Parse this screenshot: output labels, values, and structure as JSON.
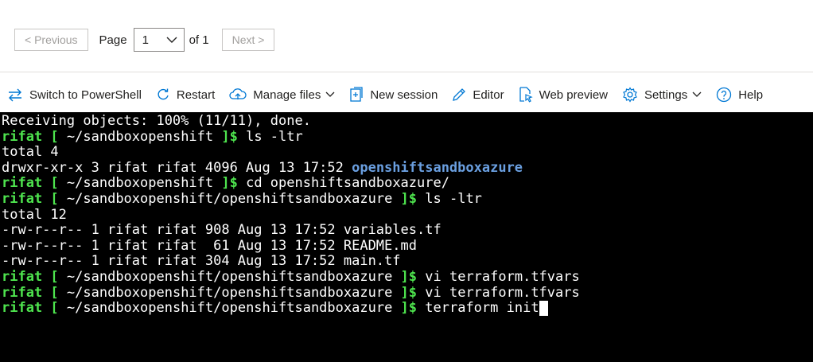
{
  "pagination": {
    "previous_label": "< Previous",
    "page_label": "Page",
    "current_page": "1",
    "of_label": "of 1",
    "next_label": "Next >"
  },
  "toolbar": {
    "switch_label": "Switch to PowerShell",
    "restart_label": "Restart",
    "manage_files_label": "Manage files",
    "new_session_label": "New session",
    "editor_label": "Editor",
    "web_preview_label": "Web preview",
    "settings_label": "Settings",
    "help_label": "Help"
  },
  "terminal": {
    "prompt_user": "rifat",
    "lines": [
      {
        "type": "output",
        "text": "Receiving objects: 100% (11/11), done."
      },
      {
        "type": "prompt",
        "path": "~/sandboxopenshift",
        "cmd": "ls -ltr"
      },
      {
        "type": "output",
        "text": "total 4"
      },
      {
        "type": "dirline",
        "text": "drwxr-xr-x 3 rifat rifat 4096 Aug 13 17:52 ",
        "dir": "openshiftsandboxazure"
      },
      {
        "type": "prompt",
        "path": "~/sandboxopenshift",
        "cmd": "cd openshiftsandboxazure/"
      },
      {
        "type": "prompt",
        "path": "~/sandboxopenshift/openshiftsandboxazure",
        "cmd": "ls -ltr"
      },
      {
        "type": "output",
        "text": "total 12"
      },
      {
        "type": "output",
        "text": "-rw-r--r-- 1 rifat rifat 908 Aug 13 17:52 variables.tf"
      },
      {
        "type": "output",
        "text": "-rw-r--r-- 1 rifat rifat  61 Aug 13 17:52 README.md"
      },
      {
        "type": "output",
        "text": "-rw-r--r-- 1 rifat rifat 304 Aug 13 17:52 main.tf"
      },
      {
        "type": "prompt",
        "path": "~/sandboxopenshift/openshiftsandboxazure",
        "cmd": "vi terraform.tfvars"
      },
      {
        "type": "prompt",
        "path": "~/sandboxopenshift/openshiftsandboxazure",
        "cmd": "vi terraform.tfvars"
      },
      {
        "type": "prompt",
        "path": "~/sandboxopenshift/openshiftsandboxazure",
        "cmd": "terraform init",
        "cursor": true
      }
    ]
  },
  "colors": {
    "prompt_green": "#4ee44e",
    "dir_blue": "#6a9fe0",
    "accent_blue": "#0078d4",
    "terminal_bg": "#000000"
  },
  "icons": [
    "switch-icon",
    "restart-icon",
    "manage-files-icon",
    "new-session-icon",
    "editor-icon",
    "web-preview-icon",
    "settings-icon",
    "help-icon",
    "chevron-down-icon"
  ]
}
